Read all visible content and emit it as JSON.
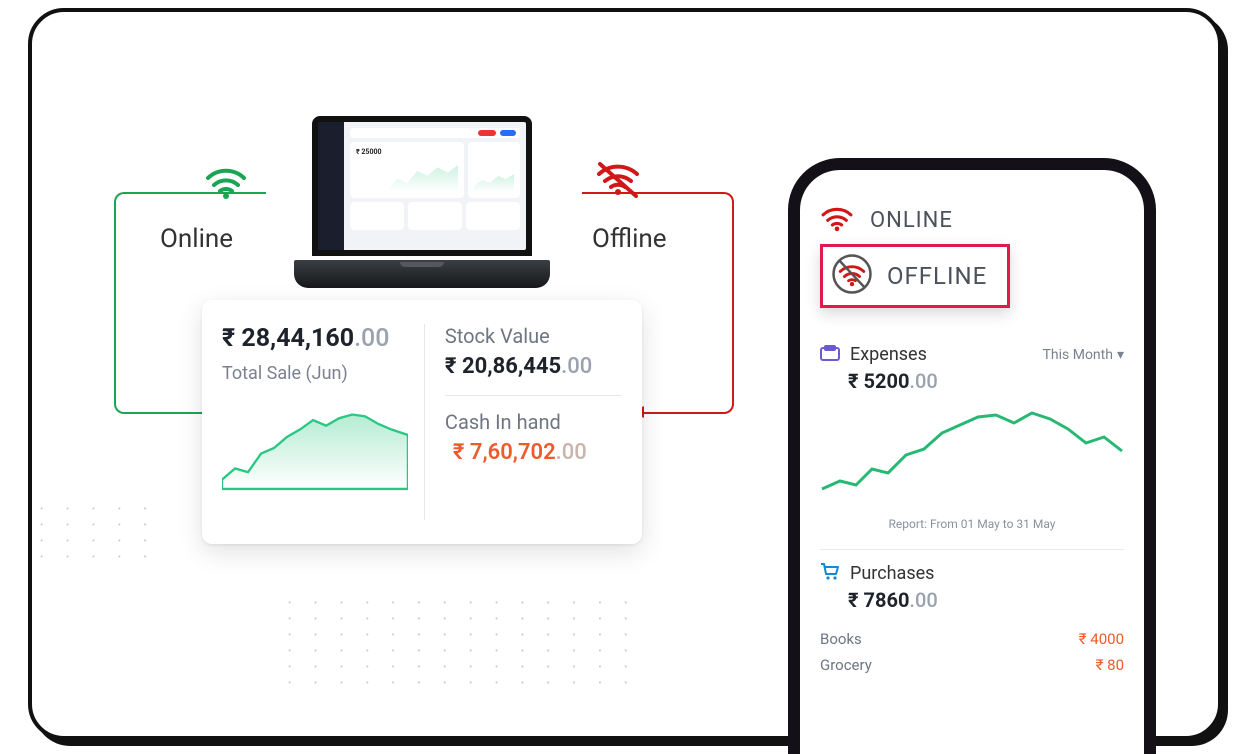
{
  "colors": {
    "green": "#1aa553",
    "red": "#d01818",
    "accent_red": "#e11a4b",
    "orange": "#ef5a2b",
    "spark": "#2ac782"
  },
  "top": {
    "online_label": "Online",
    "offline_label": "Offline",
    "laptop_amount": "₹ 25000"
  },
  "stats_card": {
    "total_sale": {
      "currency": "₹",
      "value": "28,44,160",
      "decimals": ".00",
      "label": "Total Sale (Jun)"
    },
    "stock_value": {
      "label": "Stock Value",
      "currency": "₹",
      "value": "20,86,445",
      "decimals": ".00"
    },
    "cash_in_hand": {
      "label": "Cash In hand",
      "currency": "₹",
      "value": "7,60,702",
      "decimals": ".00"
    }
  },
  "phone": {
    "online_label": "ONLINE",
    "offline_label": "OFFLINE",
    "expenses": {
      "title": "Expenses",
      "range": "This Month",
      "currency": "₹",
      "value": "5200",
      "decimals": ".00",
      "report_note": "Report: From 01 May to 31 May"
    },
    "purchases": {
      "title": "Purchases",
      "currency": "₹",
      "value": "7860",
      "decimals": ".00",
      "items": [
        {
          "name": "Books",
          "amount": "₹ 4000"
        },
        {
          "name": "Grocery",
          "amount": "₹ 80"
        }
      ]
    }
  },
  "chart_data": [
    {
      "type": "area",
      "title": "Total Sale (Jun) sparkline",
      "x": [
        0,
        1,
        2,
        3,
        4,
        5,
        6,
        7,
        8,
        9,
        10,
        11,
        12,
        13
      ],
      "values": [
        8,
        14,
        12,
        24,
        30,
        38,
        44,
        52,
        48,
        54,
        58,
        56,
        50,
        46
      ],
      "ylim": [
        0,
        60
      ]
    },
    {
      "type": "line",
      "title": "Expenses (May) sparkline",
      "x": [
        0,
        1,
        2,
        3,
        4,
        5,
        6,
        7,
        8,
        9,
        10,
        11,
        12,
        13,
        14,
        15
      ],
      "values": [
        12,
        16,
        14,
        22,
        20,
        30,
        34,
        44,
        50,
        56,
        58,
        54,
        60,
        56,
        48,
        42
      ],
      "ylim": [
        0,
        70
      ]
    }
  ]
}
